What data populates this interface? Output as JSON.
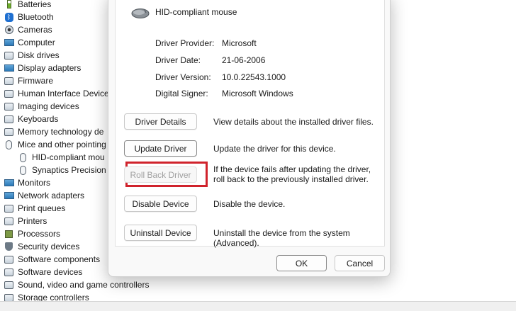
{
  "device_tree": {
    "items": [
      {
        "label": "Batteries",
        "icon": "battery-icon"
      },
      {
        "label": "Bluetooth",
        "icon": "bluetooth-icon"
      },
      {
        "label": "Cameras",
        "icon": "camera-icon"
      },
      {
        "label": "Computer",
        "icon": "computer-icon"
      },
      {
        "label": "Disk drives",
        "icon": "disk-drive-icon"
      },
      {
        "label": "Display adapters",
        "icon": "display-adapter-icon"
      },
      {
        "label": "Firmware",
        "icon": "firmware-icon"
      },
      {
        "label": "Human Interface Device",
        "icon": "hid-icon"
      },
      {
        "label": "Imaging devices",
        "icon": "imaging-icon"
      },
      {
        "label": "Keyboards",
        "icon": "keyboard-icon"
      },
      {
        "label": "Memory technology de",
        "icon": "memory-icon"
      },
      {
        "label": "Mice and other pointing",
        "icon": "mouse-icon"
      },
      {
        "label": "HID-compliant mou",
        "icon": "mouse-icon"
      },
      {
        "label": "Synaptics Precision",
        "icon": "mouse-icon"
      },
      {
        "label": "Monitors",
        "icon": "monitor-icon"
      },
      {
        "label": "Network adapters",
        "icon": "network-icon"
      },
      {
        "label": "Print queues",
        "icon": "print-queue-icon"
      },
      {
        "label": "Printers",
        "icon": "printer-icon"
      },
      {
        "label": "Processors",
        "icon": "processor-icon"
      },
      {
        "label": "Security devices",
        "icon": "security-icon"
      },
      {
        "label": "Software components",
        "icon": "software-component-icon"
      },
      {
        "label": "Software devices",
        "icon": "software-device-icon"
      },
      {
        "label": "Sound, video and game controllers",
        "icon": "sound-icon"
      },
      {
        "label": "Storage controllers",
        "icon": "storage-icon"
      }
    ]
  },
  "dialog": {
    "device_name": "HID-compliant mouse",
    "properties": [
      {
        "label": "Driver Provider:",
        "value": "Microsoft"
      },
      {
        "label": "Driver Date:",
        "value": "21-06-2006"
      },
      {
        "label": "Driver Version:",
        "value": "10.0.22543.1000"
      },
      {
        "label": "Digital Signer:",
        "value": "Microsoft Windows"
      }
    ],
    "actions": [
      {
        "label": "Driver Details",
        "description": "View details about the installed driver files.",
        "enabled": true
      },
      {
        "label": "Update Driver",
        "description": "Update the driver for this device.",
        "enabled": true
      },
      {
        "label": "Roll Back Driver",
        "description": "If the device fails after updating the driver, roll back to the previously installed driver.",
        "enabled": false
      },
      {
        "label": "Disable Device",
        "description": "Disable the device.",
        "enabled": true
      },
      {
        "label": "Uninstall Device",
        "description": "Uninstall the device from the system (Advanced).",
        "enabled": true
      }
    ],
    "ok_label": "OK",
    "cancel_label": "Cancel"
  },
  "colors": {
    "highlight_border": "#d0232c",
    "disabled_text": "#a0a0a0"
  }
}
